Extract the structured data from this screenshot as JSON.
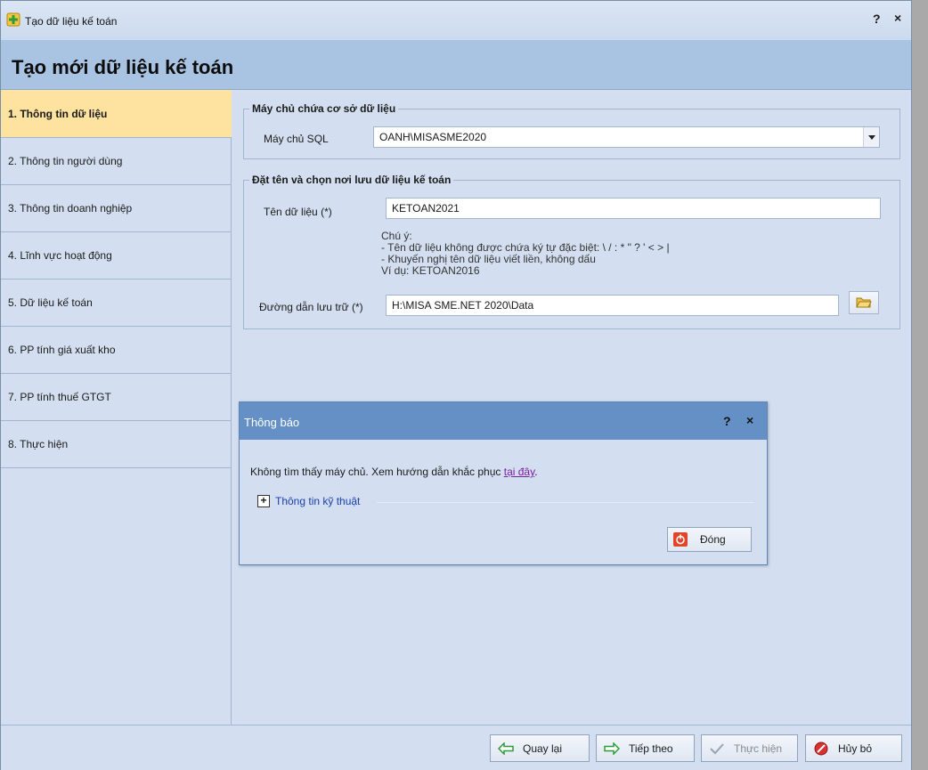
{
  "window": {
    "title": "Tạo dữ liệu kế toán",
    "help": "?",
    "close": "×"
  },
  "header": {
    "title": "Tạo mới dữ liệu kế toán"
  },
  "sidebar": {
    "items": [
      {
        "label": "1. Thông tin dữ liệu",
        "active": true
      },
      {
        "label": "2. Thông tin người dùng"
      },
      {
        "label": "3. Thông tin doanh nghiệp"
      },
      {
        "label": "4. Lĩnh vực hoạt động"
      },
      {
        "label": "5. Dữ liệu kế toán"
      },
      {
        "label": "6. PP tính giá xuất kho"
      },
      {
        "label": "7. PP tính thuế GTGT"
      },
      {
        "label": "8. Thực hiện"
      }
    ]
  },
  "server_group": {
    "legend": "Máy chủ chứa cơ sở dữ liệu",
    "sql_label": "Máy chủ SQL",
    "sql_value": "OANH\\MISASME2020"
  },
  "name_group": {
    "legend": "Đặt tên và chọn nơi lưu dữ liệu kế toán",
    "name_label": "Tên dữ liệu (*)",
    "name_value": "KETOAN2021",
    "note_lines": [
      "Chú ý:",
      "- Tên dữ liệu không được chứa ký tự đặc biệt: \\ / : * \" ? ' < > |",
      "- Khuyến nghị tên dữ liệu viết liền, không dấu",
      "Ví dụ: KETOAN2016"
    ],
    "path_label": "Đường dẫn lưu trữ (*)",
    "path_value": "H:\\MISA SME.NET 2020\\Data"
  },
  "footer": {
    "back": "Quay lại",
    "next": "Tiếp theo",
    "execute": "Thực hiện",
    "cancel": "Hủy bỏ"
  },
  "dialog": {
    "title": "Thông báo",
    "help": "?",
    "close": "×",
    "message": "Không tìm thấy máy chủ. Xem hướng dẫn khắc phục ",
    "link": "tại đây",
    "message_end": ".",
    "expander_box": "+",
    "expander": "Thông tin kỹ thuật",
    "close_button": "Đóng"
  },
  "colors": {
    "window_bg": "#d3dff0",
    "header_bg": "#a9c4e3",
    "active_step": "#fde2a0",
    "dialog_title_bg": "#6590c5",
    "link": "#7a1fa2"
  }
}
